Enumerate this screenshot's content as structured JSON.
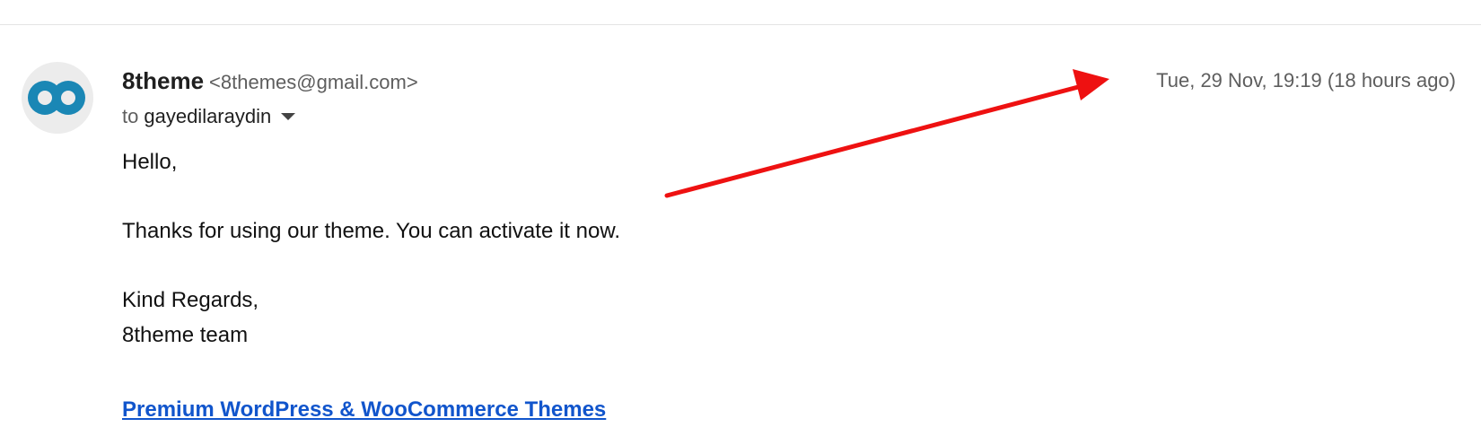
{
  "email": {
    "sender": {
      "name": "8theme",
      "email": "<8themes@gmail.com>",
      "avatar_icon": "8theme-logo-icon"
    },
    "recipient": {
      "prefix": "to",
      "name": "gayedilaraydin",
      "toggle_icon": "chevron-down-icon"
    },
    "timestamp": "Tue, 29 Nov, 19:19 (18 hours ago)",
    "body": {
      "greeting": "Hello,",
      "message": "Thanks for using our theme. You can activate it now.",
      "closing": "Kind Regards,",
      "signature": "8theme team",
      "link_text": "Premium WordPress & WooCommerce Themes"
    }
  },
  "colors": {
    "link": "#1155cc",
    "annotation_arrow": "#ee1111",
    "logo_blue": "#1a87b5"
  }
}
